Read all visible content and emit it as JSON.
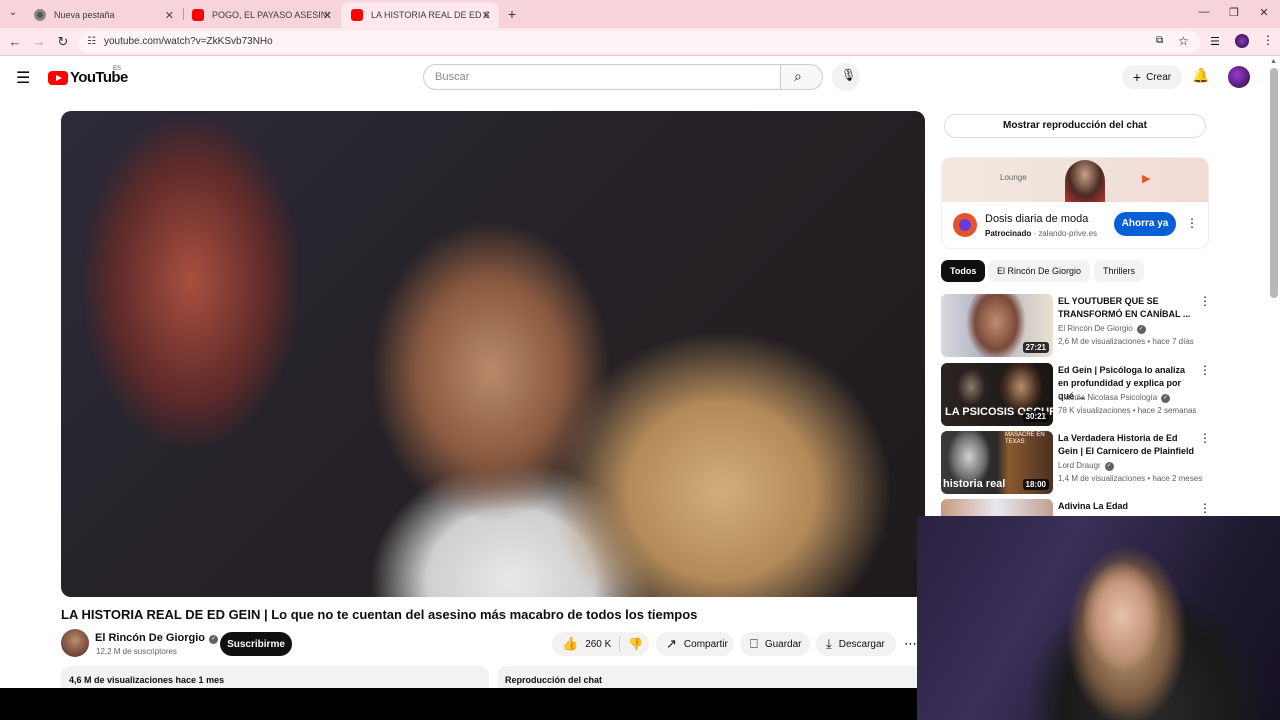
{
  "browser": {
    "tabs": [
      {
        "title": "Nueva pestaña",
        "active": false
      },
      {
        "title": "POGO, EL PAYASO ASESINO | C",
        "active": false
      },
      {
        "title": "LA HISTORIA REAL DE ED GEIN",
        "active": true
      }
    ],
    "url": "youtube.com/watch?v=ZkKSvb73NHo"
  },
  "youtube": {
    "logo_text": "YouTube",
    "logo_region": "ES",
    "search_placeholder": "Buscar",
    "create_label": "Crear"
  },
  "video": {
    "title": "LA HISTORIA REAL DE ED GEIN | Lo que no te cuentan del asesino más macabro de todos los tiempos",
    "channel": "El Rincón De Giorgio",
    "subscribers": "12,2 M de suscriptores",
    "subscribe_label": "Suscribirme",
    "likes": "260 K",
    "share_label": "Compartir",
    "save_label": "Guardar",
    "download_label": "Descargar",
    "views_date": "4,6 M de visualizaciones  hace 1 mes",
    "chat_replay_label": "Reproducción del chat"
  },
  "sidebar": {
    "show_chat_label": "Mostrar reproducción del chat",
    "ad": {
      "banner_text": "Lounge",
      "title": "Dosis diaria de moda",
      "sponsored": "Patrocinado",
      "domain": "zalando-prive.es",
      "button": "Ahorra ya"
    },
    "chips": [
      "Todos",
      "El Rincón De Giorgio",
      "Thrillers"
    ],
    "recommendations": [
      {
        "title": "EL YOUTUBER QUE SE TRANSFORMÓ EN CANÍBAL ...",
        "channel": "El Rincón De Giorgio",
        "meta": "2,6 M de visualizaciones • hace 7 días",
        "duration": "27:21"
      },
      {
        "title": "Ed Gein | Psicóloga lo analiza en profundidad y explica por qué ...",
        "channel": "Claudia Nicolasa Psicología",
        "meta": "78 K visualizaciones • hace 2 semanas",
        "duration": "30:21",
        "thumb_text": "LA PSICOSIS OSCURA"
      },
      {
        "title": "La Verdadera Historia de Ed Gein | El Carnicero de Plainfield",
        "channel": "Lord Draugr",
        "meta": "1,4 M de visualizaciones • hace 2 meses",
        "duration": "18:00",
        "thumb_text": "historia real",
        "thumb_text2": "MASACRE EN TEXAS"
      },
      {
        "title": "Adivina La Edad",
        "channel": "",
        "meta": "",
        "duration": ""
      }
    ]
  }
}
